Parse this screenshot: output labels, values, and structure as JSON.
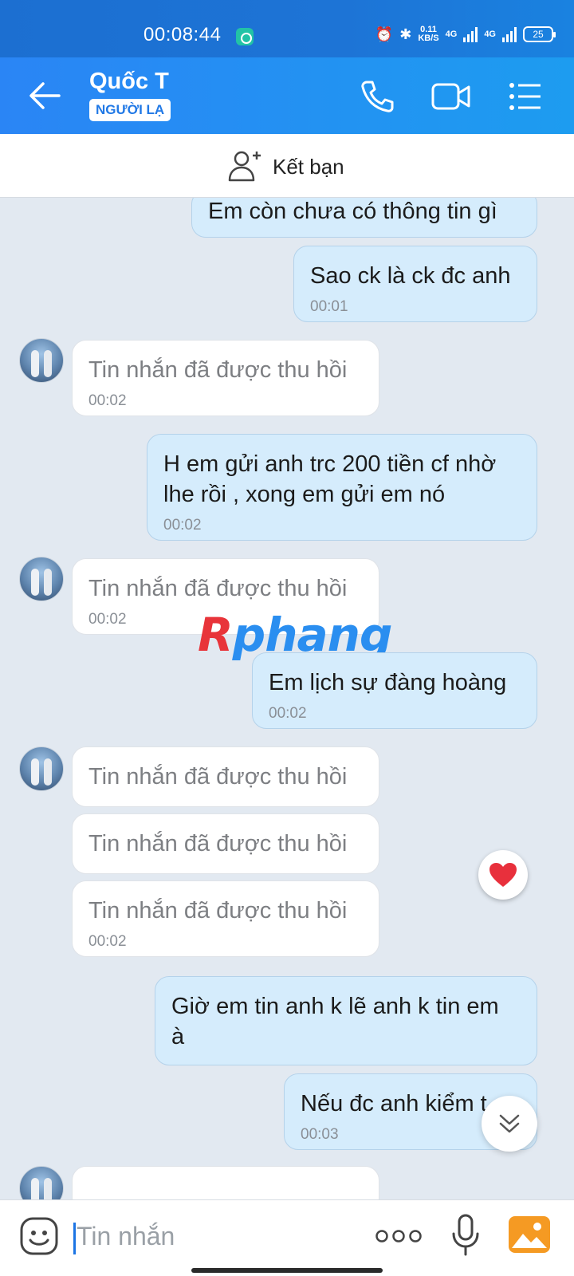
{
  "status_bar": {
    "time": "00:08:44",
    "net_speed_value": "0.11",
    "net_speed_unit": "KB/S",
    "signal_1": "4G",
    "signal_2": "4G",
    "battery": "25"
  },
  "header": {
    "contact_name": "Quốc T",
    "badge": "NGƯỜI LẠ"
  },
  "add_friend": {
    "label": "Kết bạn"
  },
  "watermark": {
    "first": "R",
    "rest": "phang"
  },
  "messages": [
    {
      "text": "Em còn chưa có thông tin gì",
      "time": ""
    },
    {
      "text": "Sao ck là ck đc anh",
      "time": "00:01"
    },
    {
      "text": "Tin nhắn đã được thu hồi",
      "time": "00:02"
    },
    {
      "line1": "H em gửi anh trc 200 tiền cf nhờ",
      "line2": "lhe rồi , xong em gửi em nó",
      "time": "00:02"
    },
    {
      "text": "Tin nhắn đã được thu hồi",
      "time": "00:02"
    },
    {
      "text": "Em lịch sự đàng hoàng",
      "time": "00:02"
    },
    {
      "text": "Tin nhắn đã được thu hồi",
      "time": ""
    },
    {
      "text": "Tin nhắn đã được thu hồi",
      "time": ""
    },
    {
      "text": "Tin nhắn đã được thu hồi",
      "time": "00:02"
    },
    {
      "line1": "Giờ em tin anh k lẽ anh k tin em",
      "line2": "à",
      "time": ""
    },
    {
      "text": "Nếu đc anh kiểm t",
      "time": "00:03"
    }
  ],
  "reaction": {
    "icon": "heart-icon",
    "color": "#e8303c"
  },
  "input": {
    "placeholder": "Tin nhắn"
  },
  "colors": {
    "header": "#1d8cf0",
    "my_bubble": "#d5ecfc",
    "their_bubble": "#ffffff",
    "chat_bg": "#e2e9f1"
  }
}
